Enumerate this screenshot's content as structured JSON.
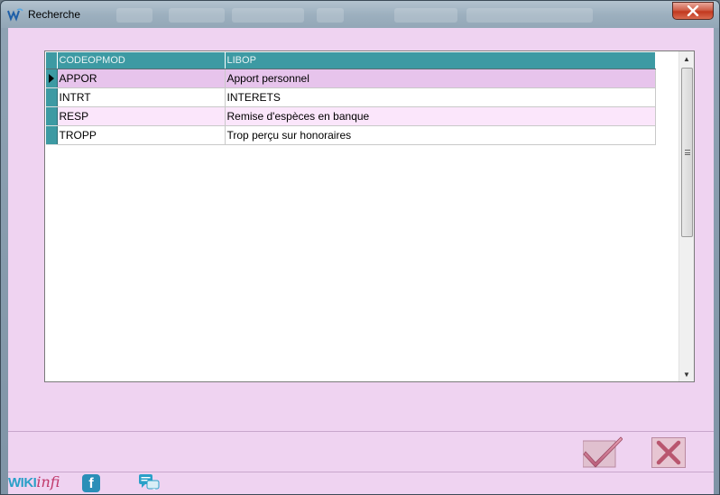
{
  "window": {
    "title": "Recherche",
    "close_label": "✕"
  },
  "grid": {
    "columns": [
      "CODEOPMOD",
      "LIBOP"
    ],
    "rows": [
      {
        "code": "APPOR",
        "label": "Apport personnel",
        "selected": true
      },
      {
        "code": "INTRT",
        "label": "INTERETS",
        "selected": false
      },
      {
        "code": "RESP",
        "label": "Remise d'espèces en banque",
        "selected": false
      },
      {
        "code": "TROPP",
        "label": "Trop perçu sur honoraires",
        "selected": false
      }
    ]
  },
  "scrollbar": {
    "up_glyph": "▲",
    "down_glyph": "▼"
  },
  "actions": {
    "ok_icon": "checkmark-icon",
    "cancel_icon": "cross-icon"
  },
  "footer": {
    "wiki_part1": "WIKI",
    "wiki_part2": "infi",
    "facebook_letter": "f"
  },
  "colors": {
    "client_bg": "#efd3f1",
    "header_bg": "#3d9aa3",
    "selected_row": "#e7c4ec",
    "alt_row": "#fbe6fb",
    "close_red": "#c2381f"
  }
}
